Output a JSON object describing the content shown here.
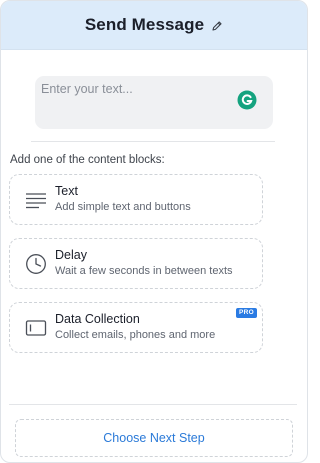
{
  "header": {
    "title": "Send Message",
    "edit_icon": "pencil-icon",
    "background": "#dcebfa"
  },
  "message_input": {
    "placeholder": "Enter your text...",
    "value": "",
    "extension_icon": "grammarly-icon"
  },
  "content_blocks": {
    "label": "Add one of the content blocks:",
    "items": [
      {
        "title": "Text",
        "description": "Add simple text and buttons",
        "icon": "text-lines-icon",
        "badge": ""
      },
      {
        "title": "Delay",
        "description": "Wait a few seconds in between texts",
        "icon": "clock-icon",
        "badge": ""
      },
      {
        "title": "Data Collection",
        "description": "Collect emails, phones and more",
        "icon": "input-field-icon",
        "badge": "PRO"
      }
    ]
  },
  "footer": {
    "next_step_label": "Choose Next Step",
    "accent": "#2b7ad8"
  }
}
